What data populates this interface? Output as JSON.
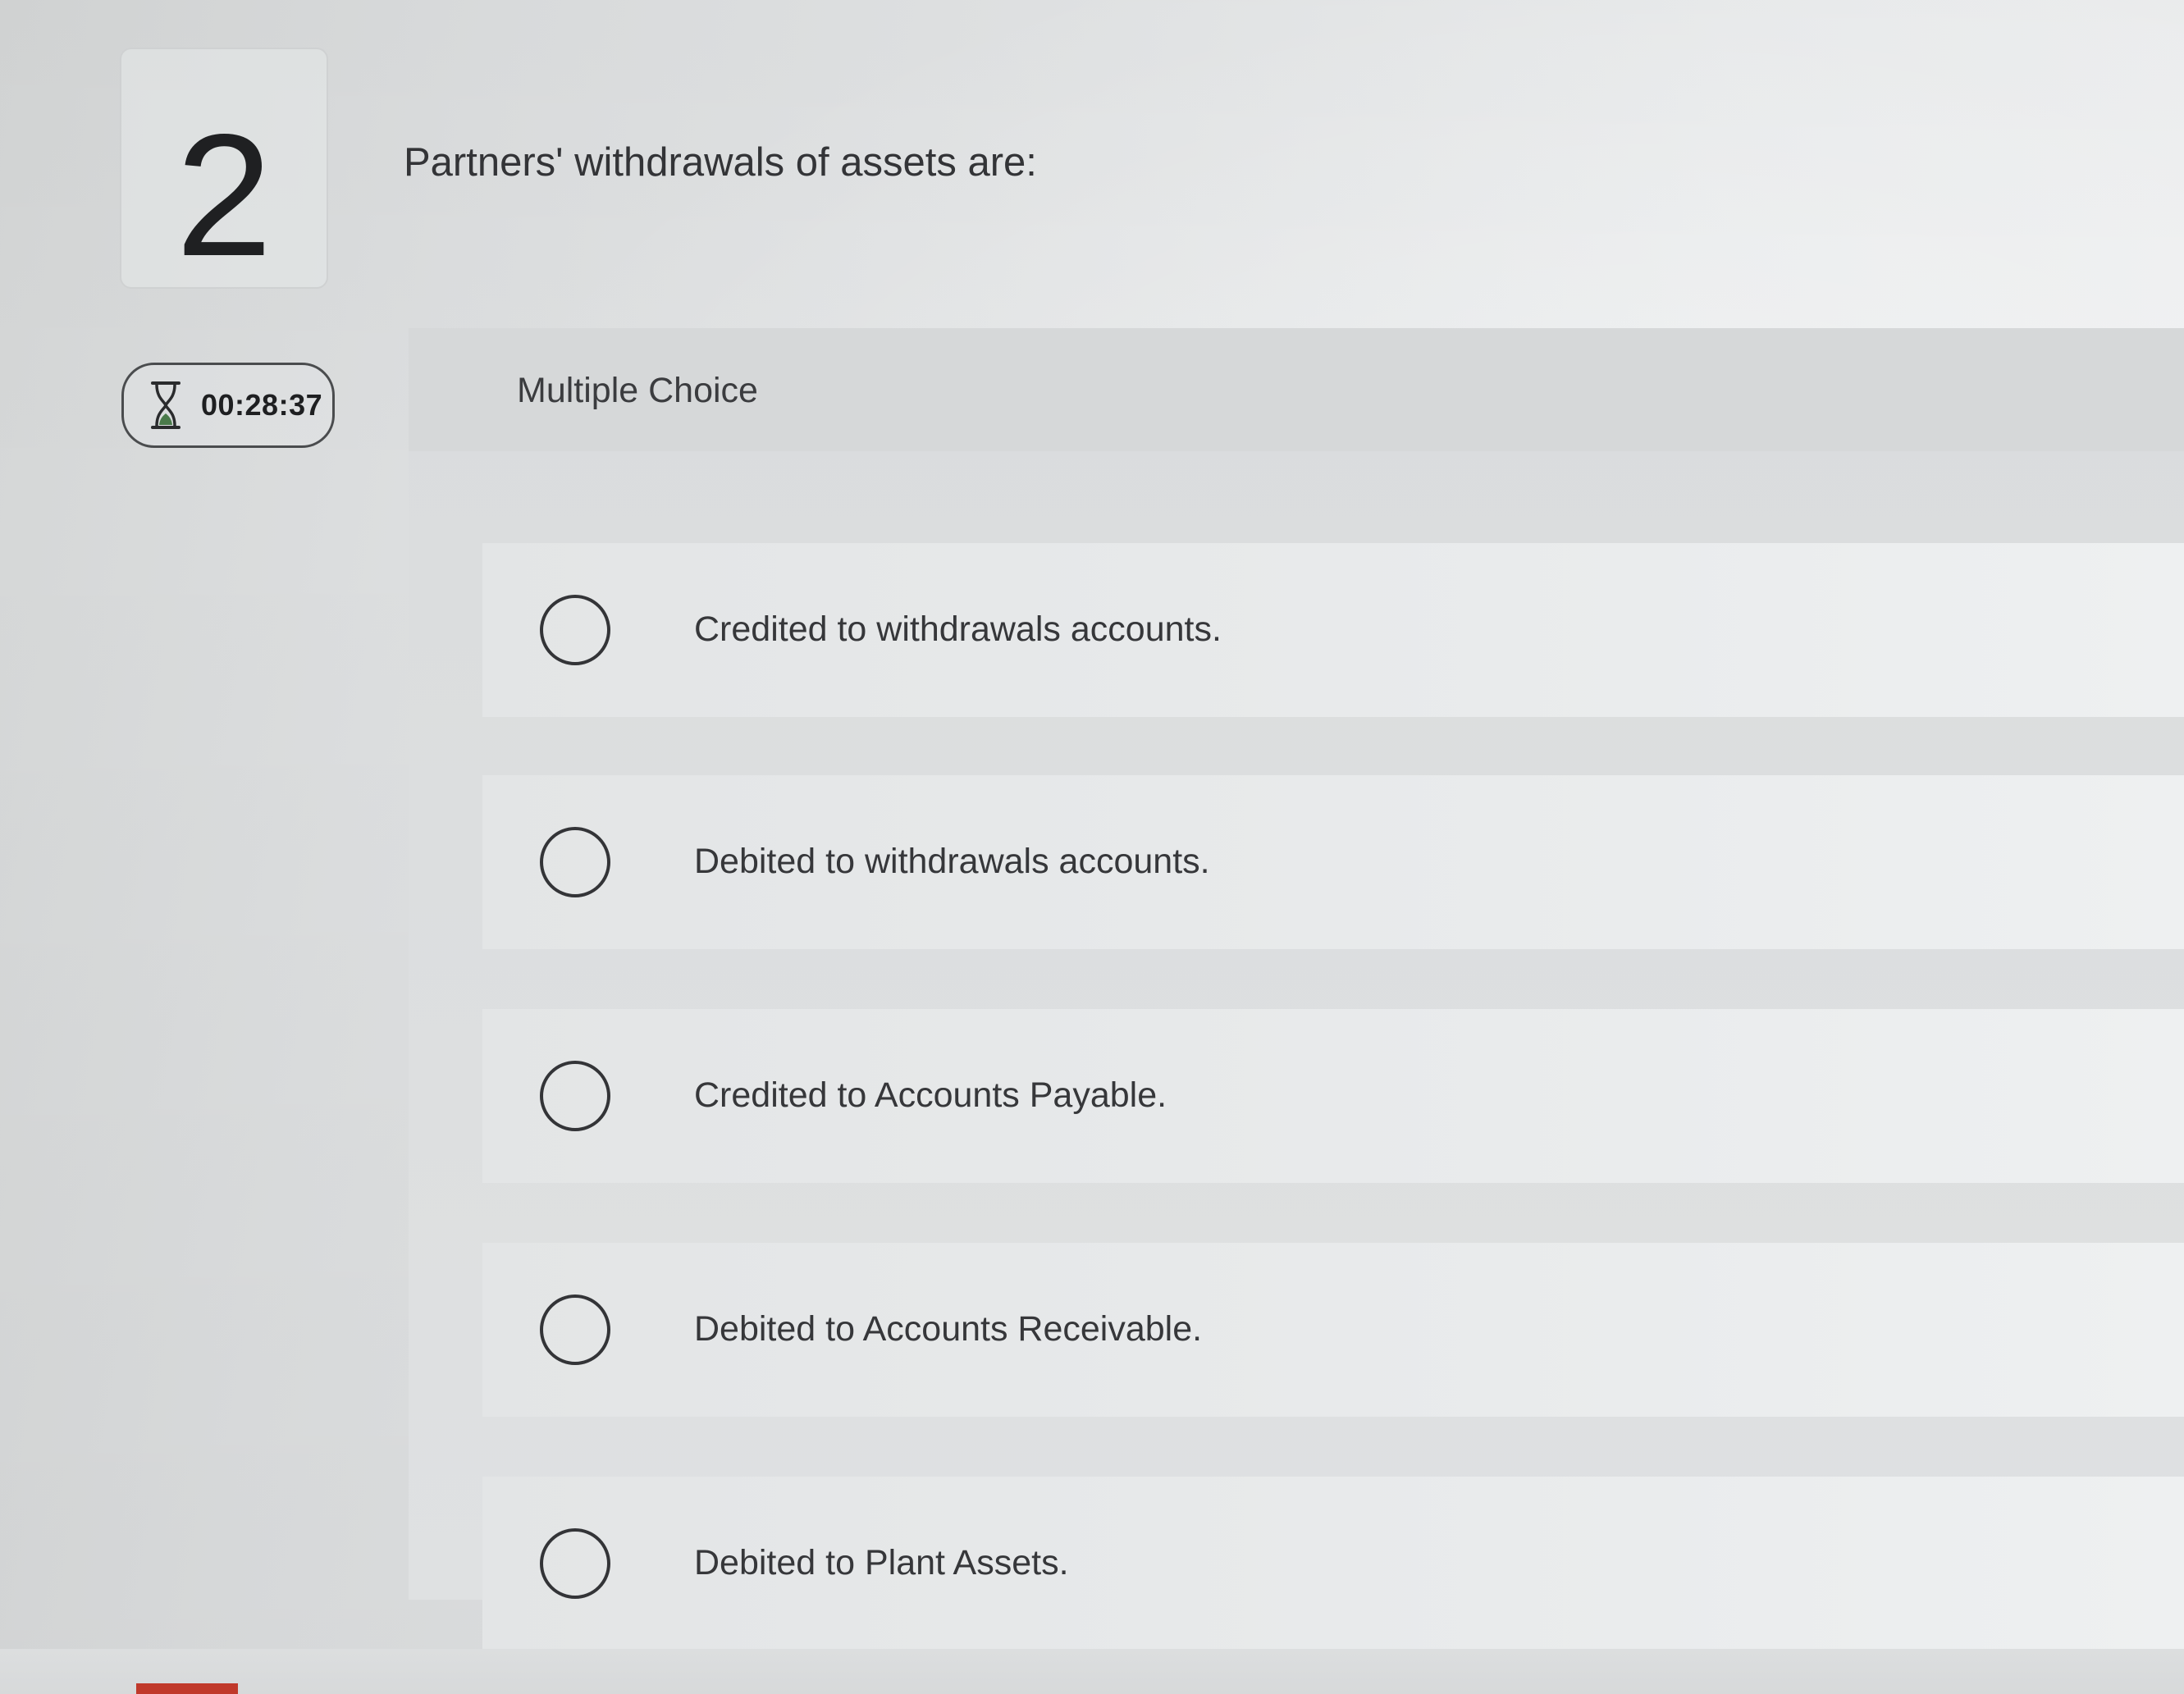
{
  "question": {
    "number": "2",
    "text": "Partners' withdrawals of assets are:"
  },
  "timer": {
    "value": "00:28:37",
    "icon": "hourglass-icon"
  },
  "panel": {
    "label": "Multiple Choice"
  },
  "choices": [
    {
      "label": "Credited to withdrawals accounts.",
      "selected": false
    },
    {
      "label": "Debited to withdrawals accounts.",
      "selected": false
    },
    {
      "label": "Credited to Accounts Payable.",
      "selected": false
    },
    {
      "label": "Debited to Accounts Receivable.",
      "selected": false
    },
    {
      "label": "Debited to Plant Assets.",
      "selected": false
    }
  ],
  "colors": {
    "accent": "#c0392b",
    "text": "#333437",
    "timer_hourglass_sand": "#4a7a4a"
  }
}
